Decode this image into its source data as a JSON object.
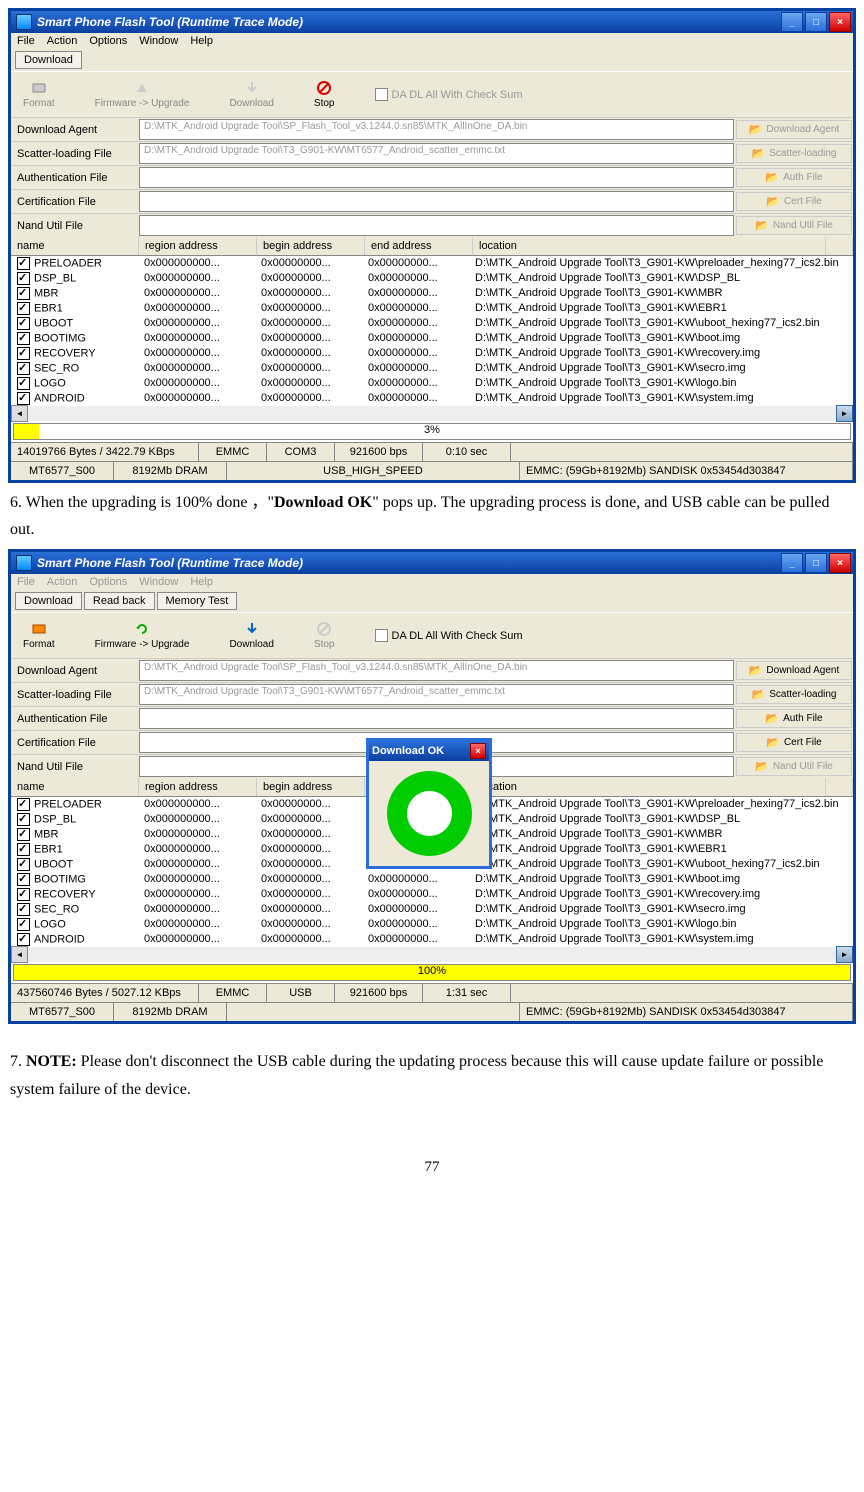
{
  "title": "Smart Phone Flash Tool (Runtime Trace Mode)",
  "menus": [
    "File",
    "Action",
    "Options",
    "Window",
    "Help"
  ],
  "tabs": {
    "dl": "Download",
    "rb": "Read back",
    "mt": "Memory Test"
  },
  "tools": {
    "format": "Format",
    "fw": "Firmware -> Upgrade",
    "dl": "Download",
    "stop": "Stop"
  },
  "chksum": "DA DL All With Check Sum",
  "flab": {
    "da": "Download Agent",
    "sc": "Scatter-loading File",
    "au": "Authentication File",
    "ce": "Certification File",
    "nu": "Nand Util File"
  },
  "fpath": {
    "da": "D:\\MTK_Android Upgrade Tool\\SP_Flash_Tool_v3.1244.0.sn85\\MTK_AllInOne_DA.bin",
    "sc": "D:\\MTK_Android Upgrade Tool\\T3_G901-KW\\MT6577_Android_scatter_emmc.txt"
  },
  "fbtn": {
    "da": "Download Agent",
    "sc": "Scatter-loading",
    "au": "Auth File",
    "ce": "Cert File",
    "nu": "Nand Util File"
  },
  "cols": {
    "n": "name",
    "r": "region address",
    "b": "begin address",
    "e": "end address",
    "l": "location"
  },
  "rows": [
    {
      "n": "PRELOADER",
      "r": "0x000000000...",
      "b": "0x00000000...",
      "e": "0x00000000...",
      "l": "D:\\MTK_Android Upgrade Tool\\T3_G901-KW\\preloader_hexing77_ics2.bin"
    },
    {
      "n": "DSP_BL",
      "r": "0x000000000...",
      "b": "0x00000000...",
      "e": "0x00000000...",
      "l": "D:\\MTK_Android Upgrade Tool\\T3_G901-KW\\DSP_BL"
    },
    {
      "n": "MBR",
      "r": "0x000000000...",
      "b": "0x00000000...",
      "e": "0x00000000...",
      "l": "D:\\MTK_Android Upgrade Tool\\T3_G901-KW\\MBR"
    },
    {
      "n": "EBR1",
      "r": "0x000000000...",
      "b": "0x00000000...",
      "e": "0x00000000...",
      "l": "D:\\MTK_Android Upgrade Tool\\T3_G901-KW\\EBR1"
    },
    {
      "n": "UBOOT",
      "r": "0x000000000...",
      "b": "0x00000000...",
      "e": "0x00000000...",
      "l": "D:\\MTK_Android Upgrade Tool\\T3_G901-KW\\uboot_hexing77_ics2.bin"
    },
    {
      "n": "BOOTIMG",
      "r": "0x000000000...",
      "b": "0x00000000...",
      "e": "0x00000000...",
      "l": "D:\\MTK_Android Upgrade Tool\\T3_G901-KW\\boot.img"
    },
    {
      "n": "RECOVERY",
      "r": "0x000000000...",
      "b": "0x00000000...",
      "e": "0x00000000...",
      "l": "D:\\MTK_Android Upgrade Tool\\T3_G901-KW\\recovery.img"
    },
    {
      "n": "SEC_RO",
      "r": "0x000000000...",
      "b": "0x00000000...",
      "e": "0x00000000...",
      "l": "D:\\MTK_Android Upgrade Tool\\T3_G901-KW\\secro.img"
    },
    {
      "n": "LOGO",
      "r": "0x000000000...",
      "b": "0x00000000...",
      "e": "0x00000000...",
      "l": "D:\\MTK_Android Upgrade Tool\\T3_G901-KW\\logo.bin"
    },
    {
      "n": "ANDROID",
      "r": "0x000000000...",
      "b": "0x00000000...",
      "e": "0x00000000...",
      "l": "D:\\MTK_Android Upgrade Tool\\T3_G901-KW\\system.img"
    }
  ],
  "s1": {
    "prog": "3%",
    "bytes": "14019766 Bytes / 3422.79 KBps",
    "emmc": "EMMC",
    "com": "COM3",
    "bps": "921600 bps",
    "time": "0:10 sec",
    "chip": "MT6577_S00",
    "dram": "8192Mb DRAM",
    "usb": "USB_HIGH_SPEED",
    "info": "EMMC: (59Gb+8192Mb) SANDISK 0x53454d303847"
  },
  "s2": {
    "prog": "100%",
    "bytes": "437560746 Bytes / 5027.12 KBps",
    "emmc": "EMMC",
    "com": "USB",
    "bps": "921600 bps",
    "time": "1:31 sec",
    "chip": "MT6577_S00",
    "dram": "8192Mb DRAM",
    "info": "EMMC: (59Gb+8192Mb) SANDISK 0x53454d303847"
  },
  "popup": "Download OK",
  "text": {
    "p6a": "6. When the upgrading is 100% done ，\"",
    "p6b": "Download OK",
    "p6c": "\" pops up. The upgrading process is done, and USB cable can be pulled out.",
    "p7a": "7. ",
    "p7b": "NOTE:",
    "p7c": " Please don't disconnect the USB cable during the updating process because this will cause update failure or possible system failure of the device.",
    "page": "77"
  }
}
